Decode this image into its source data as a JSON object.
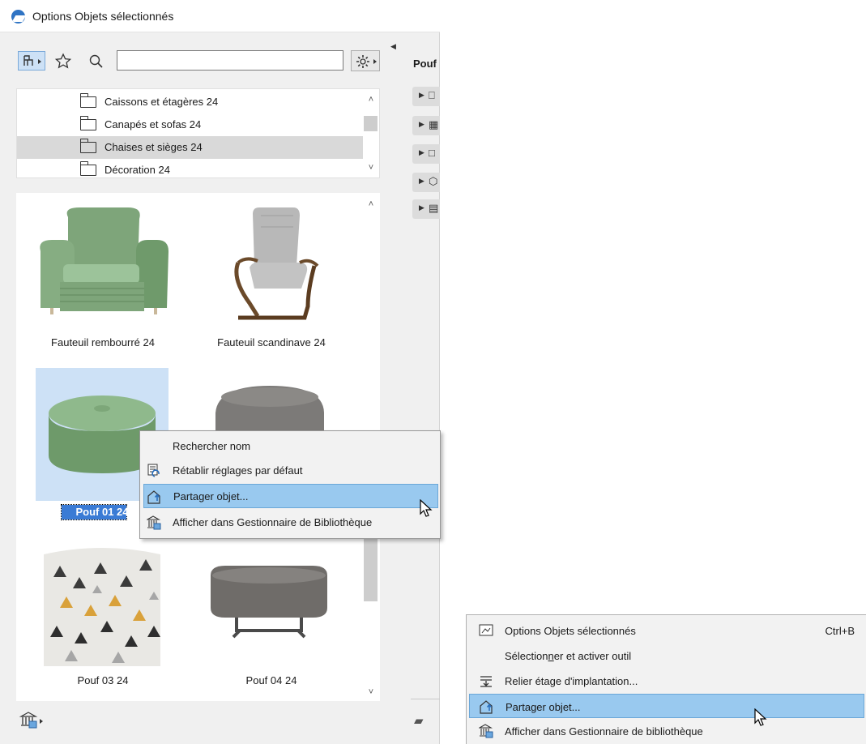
{
  "window": {
    "title": "Options Objets sélectionnés"
  },
  "toolbar": {
    "search_value": "",
    "filter_icon": "object-filter-icon",
    "favorites_icon": "star-icon",
    "search_icon": "search-icon",
    "settings_icon": "gear-icon"
  },
  "folders": [
    {
      "label": "Caissons et étagères 24",
      "selected": false
    },
    {
      "label": "Canapés et sofas 24",
      "selected": false
    },
    {
      "label": "Chaises et sièges 24",
      "selected": true
    },
    {
      "label": "Décoration 24",
      "selected": false
    }
  ],
  "gallery": {
    "items": [
      {
        "label": "Fauteuil rembourré 24",
        "selected": false
      },
      {
        "label": "Fauteuil scandinave 24",
        "selected": false
      },
      {
        "label": "Pouf 01 24",
        "selected": true
      },
      {
        "label": "",
        "selected": false
      },
      {
        "label": "Pouf 03 24",
        "selected": false
      },
      {
        "label": "Pouf 04 24",
        "selected": false
      }
    ]
  },
  "side_panel": {
    "header": "Pouf"
  },
  "context_menu": {
    "items": [
      {
        "label": "Rechercher nom",
        "icon": ""
      },
      {
        "label": "Rétablir réglages par défaut",
        "icon": "reset-defaults-icon"
      },
      {
        "label": "Partager objet...",
        "icon": "share-object-icon",
        "highlighted": true
      },
      {
        "label": "Afficher dans Gestionnaire de Bibliothèque",
        "icon": "library-manager-icon"
      }
    ]
  },
  "context_menu_2": {
    "items": [
      {
        "label": "Options Objets sélectionnés",
        "shortcut": "Ctrl+B",
        "icon": "object-settings-icon"
      },
      {
        "label_pre": "Sélection",
        "label_u": "n",
        "label_post": "er et activer outil",
        "icon": ""
      },
      {
        "label": "Relier étage d'implantation...",
        "icon": "link-story-icon"
      },
      {
        "label": "Partager objet...",
        "icon": "share-object-icon",
        "highlighted": true
      },
      {
        "label": "Afficher dans Gestionnaire de bibliothèque",
        "icon": "library-manager-icon"
      }
    ]
  },
  "colors": {
    "selection": "#cde1f6",
    "menu_highlight": "#99c9ef",
    "accent": "#2f74c4"
  }
}
